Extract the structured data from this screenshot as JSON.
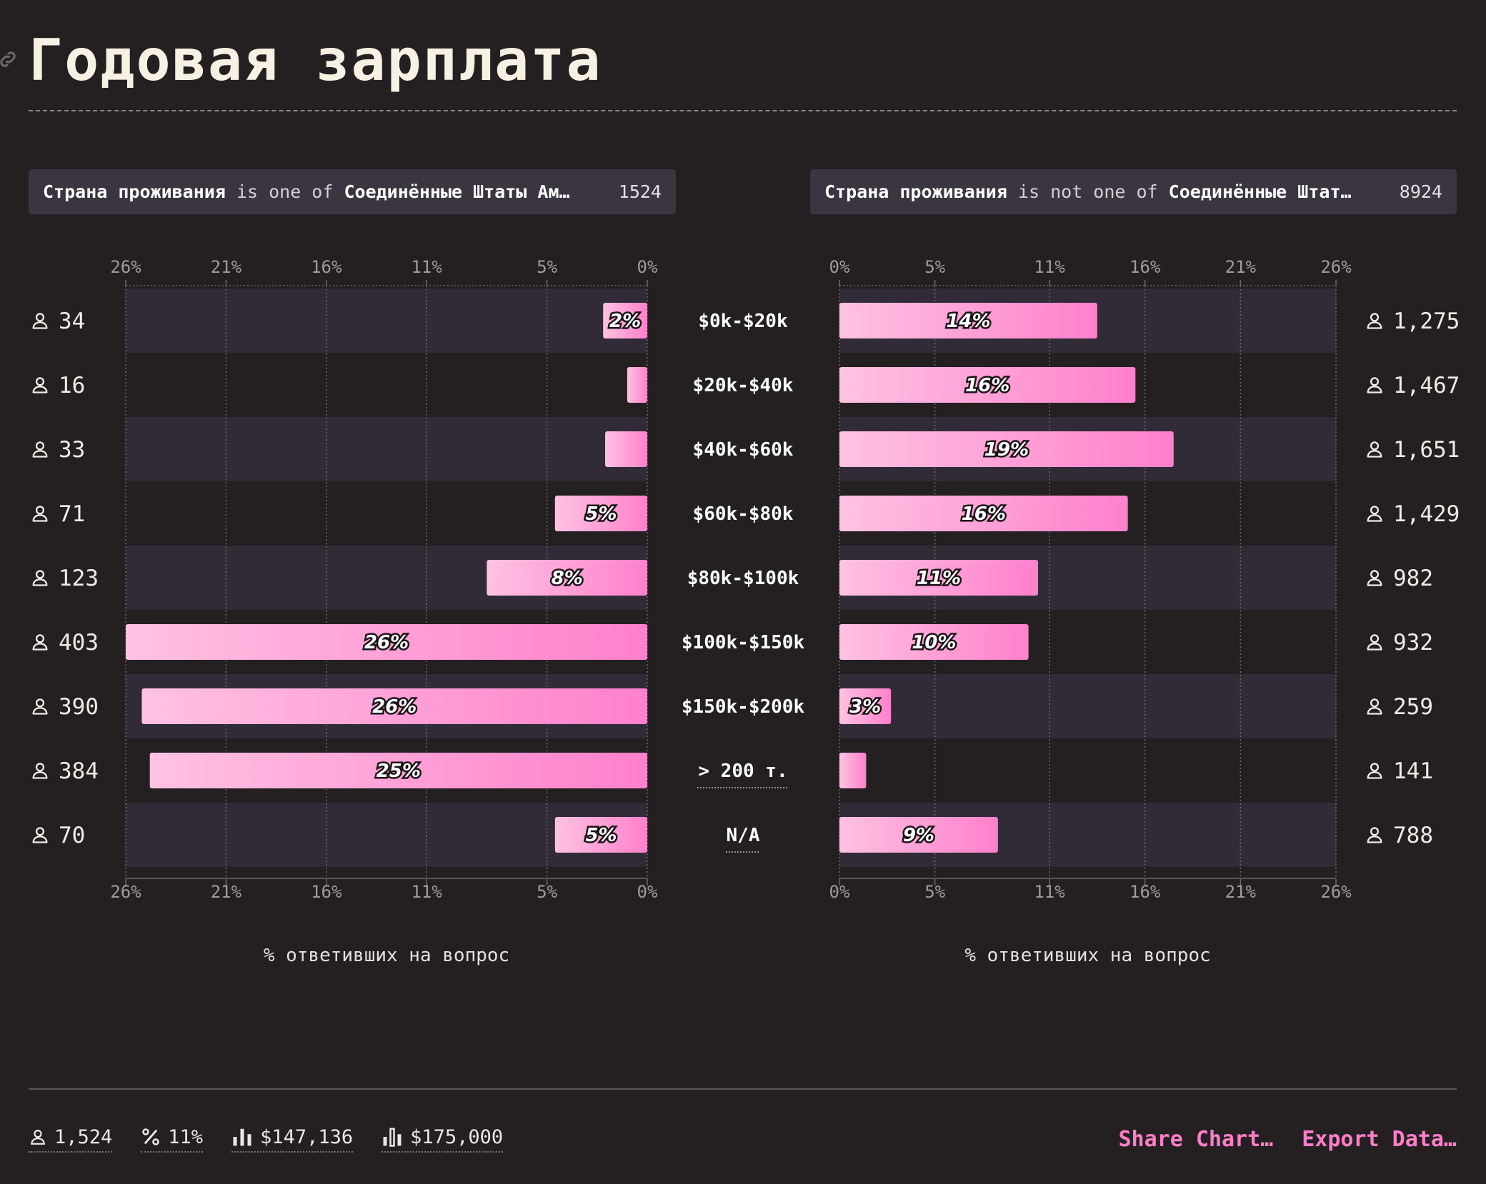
{
  "title": "Годовая зарплата",
  "filters": {
    "left": {
      "field": "Страна проживания",
      "op": "is one of",
      "value": "Соединённые Штаты Ам…",
      "count": "1524"
    },
    "right": {
      "field": "Страна проживания",
      "op": "is not one of",
      "value": "Соединённые Штат…",
      "count": "8924"
    }
  },
  "chart_data": {
    "type": "bar",
    "categories": [
      "$0k-$20k",
      "$20k-$40k",
      "$40k-$60k",
      "$60k-$80k",
      "$80k-$100k",
      "$100k-$150k",
      "$150k-$200k",
      "> 200 т.",
      "N/A"
    ],
    "xlabel": "% ответивших на вопрос",
    "xlim": [
      0,
      26
    ],
    "ticks": [
      "0%",
      "5%",
      "11%",
      "16%",
      "21%",
      "26%"
    ],
    "grid": true,
    "panels": [
      {
        "values": [
          2.2,
          1.0,
          2.1,
          4.6,
          8.0,
          26.0,
          25.2,
          24.8,
          4.6
        ],
        "labels": [
          "2%",
          "",
          "",
          "5%",
          "8%",
          "26%",
          "26%",
          "25%",
          "5%"
        ],
        "counts": [
          "34",
          "16",
          "33",
          "71",
          "123",
          "403",
          "390",
          "384",
          "70"
        ],
        "direction": "left"
      },
      {
        "values": [
          13.5,
          15.5,
          17.5,
          15.1,
          10.4,
          9.9,
          2.7,
          1.4,
          8.3
        ],
        "labels": [
          "14%",
          "16%",
          "19%",
          "16%",
          "11%",
          "10%",
          "3%",
          "",
          "9%"
        ],
        "counts": [
          "1,275",
          "1,467",
          "1,651",
          "1,429",
          "982",
          "932",
          "259",
          "141",
          "788"
        ],
        "direction": "right"
      }
    ]
  },
  "footer": {
    "respondents": "1,524",
    "percent": "11%",
    "mean": "$147,136",
    "median": "$175,000",
    "share_label": "Share Chart…",
    "export_label": "Export Data…"
  },
  "colors": {
    "bar_start": "#ffc2e2",
    "bar_end": "#ff80cc",
    "row_alt": "#302b37",
    "accent": "#ff7ec9"
  }
}
